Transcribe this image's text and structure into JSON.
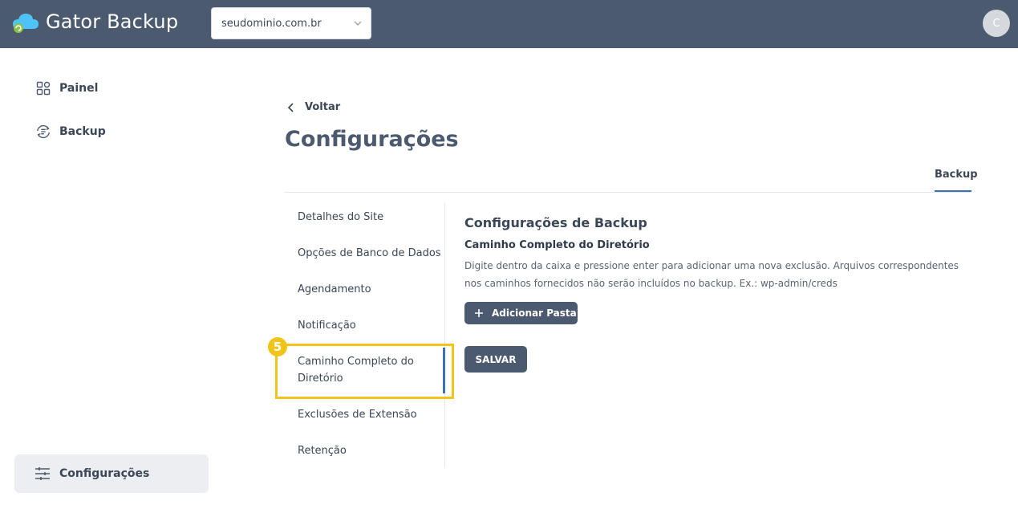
{
  "header": {
    "brand": "Gator Backup",
    "domain_select": "seudominio.com.br",
    "avatar_initial": "C",
    "colors": {
      "bar": "#4b5a6e"
    }
  },
  "sidebar": {
    "items": [
      {
        "label": "Painel",
        "icon": "dashboard-icon"
      },
      {
        "label": "Backup",
        "icon": "backup-sync-icon"
      }
    ],
    "settings": {
      "label": "Configurações",
      "icon": "sliders-icon"
    }
  },
  "main": {
    "back_label": "Voltar",
    "title": "Configurações",
    "tabs": [
      {
        "label": "Backup",
        "active": true
      }
    ]
  },
  "settings_menu": {
    "items": [
      "Detalhes do Site",
      "Opções de Banco de Dados",
      "Agendamento",
      "Notificação",
      "Caminho Completo do Diretório",
      "Exclusões de Extensão",
      "Retenção"
    ],
    "active_index": 4,
    "step_badge": "5"
  },
  "panel": {
    "section_title": "Configurações de Backup",
    "sub_title": "Caminho Completo do Diretório",
    "description": "Digite dentro da caixa e pressione enter para adicionar uma nova exclusão. Arquivos correspondentes nos caminhos fornecidos não serão incluídos no backup. Ex.: wp-admin/creds",
    "add_button": "Adicionar Pasta",
    "save_button": "SALVAR"
  },
  "colors": {
    "accent": "#3b6fb6",
    "highlight": "#f0c419",
    "button": "#4b5a6e"
  }
}
